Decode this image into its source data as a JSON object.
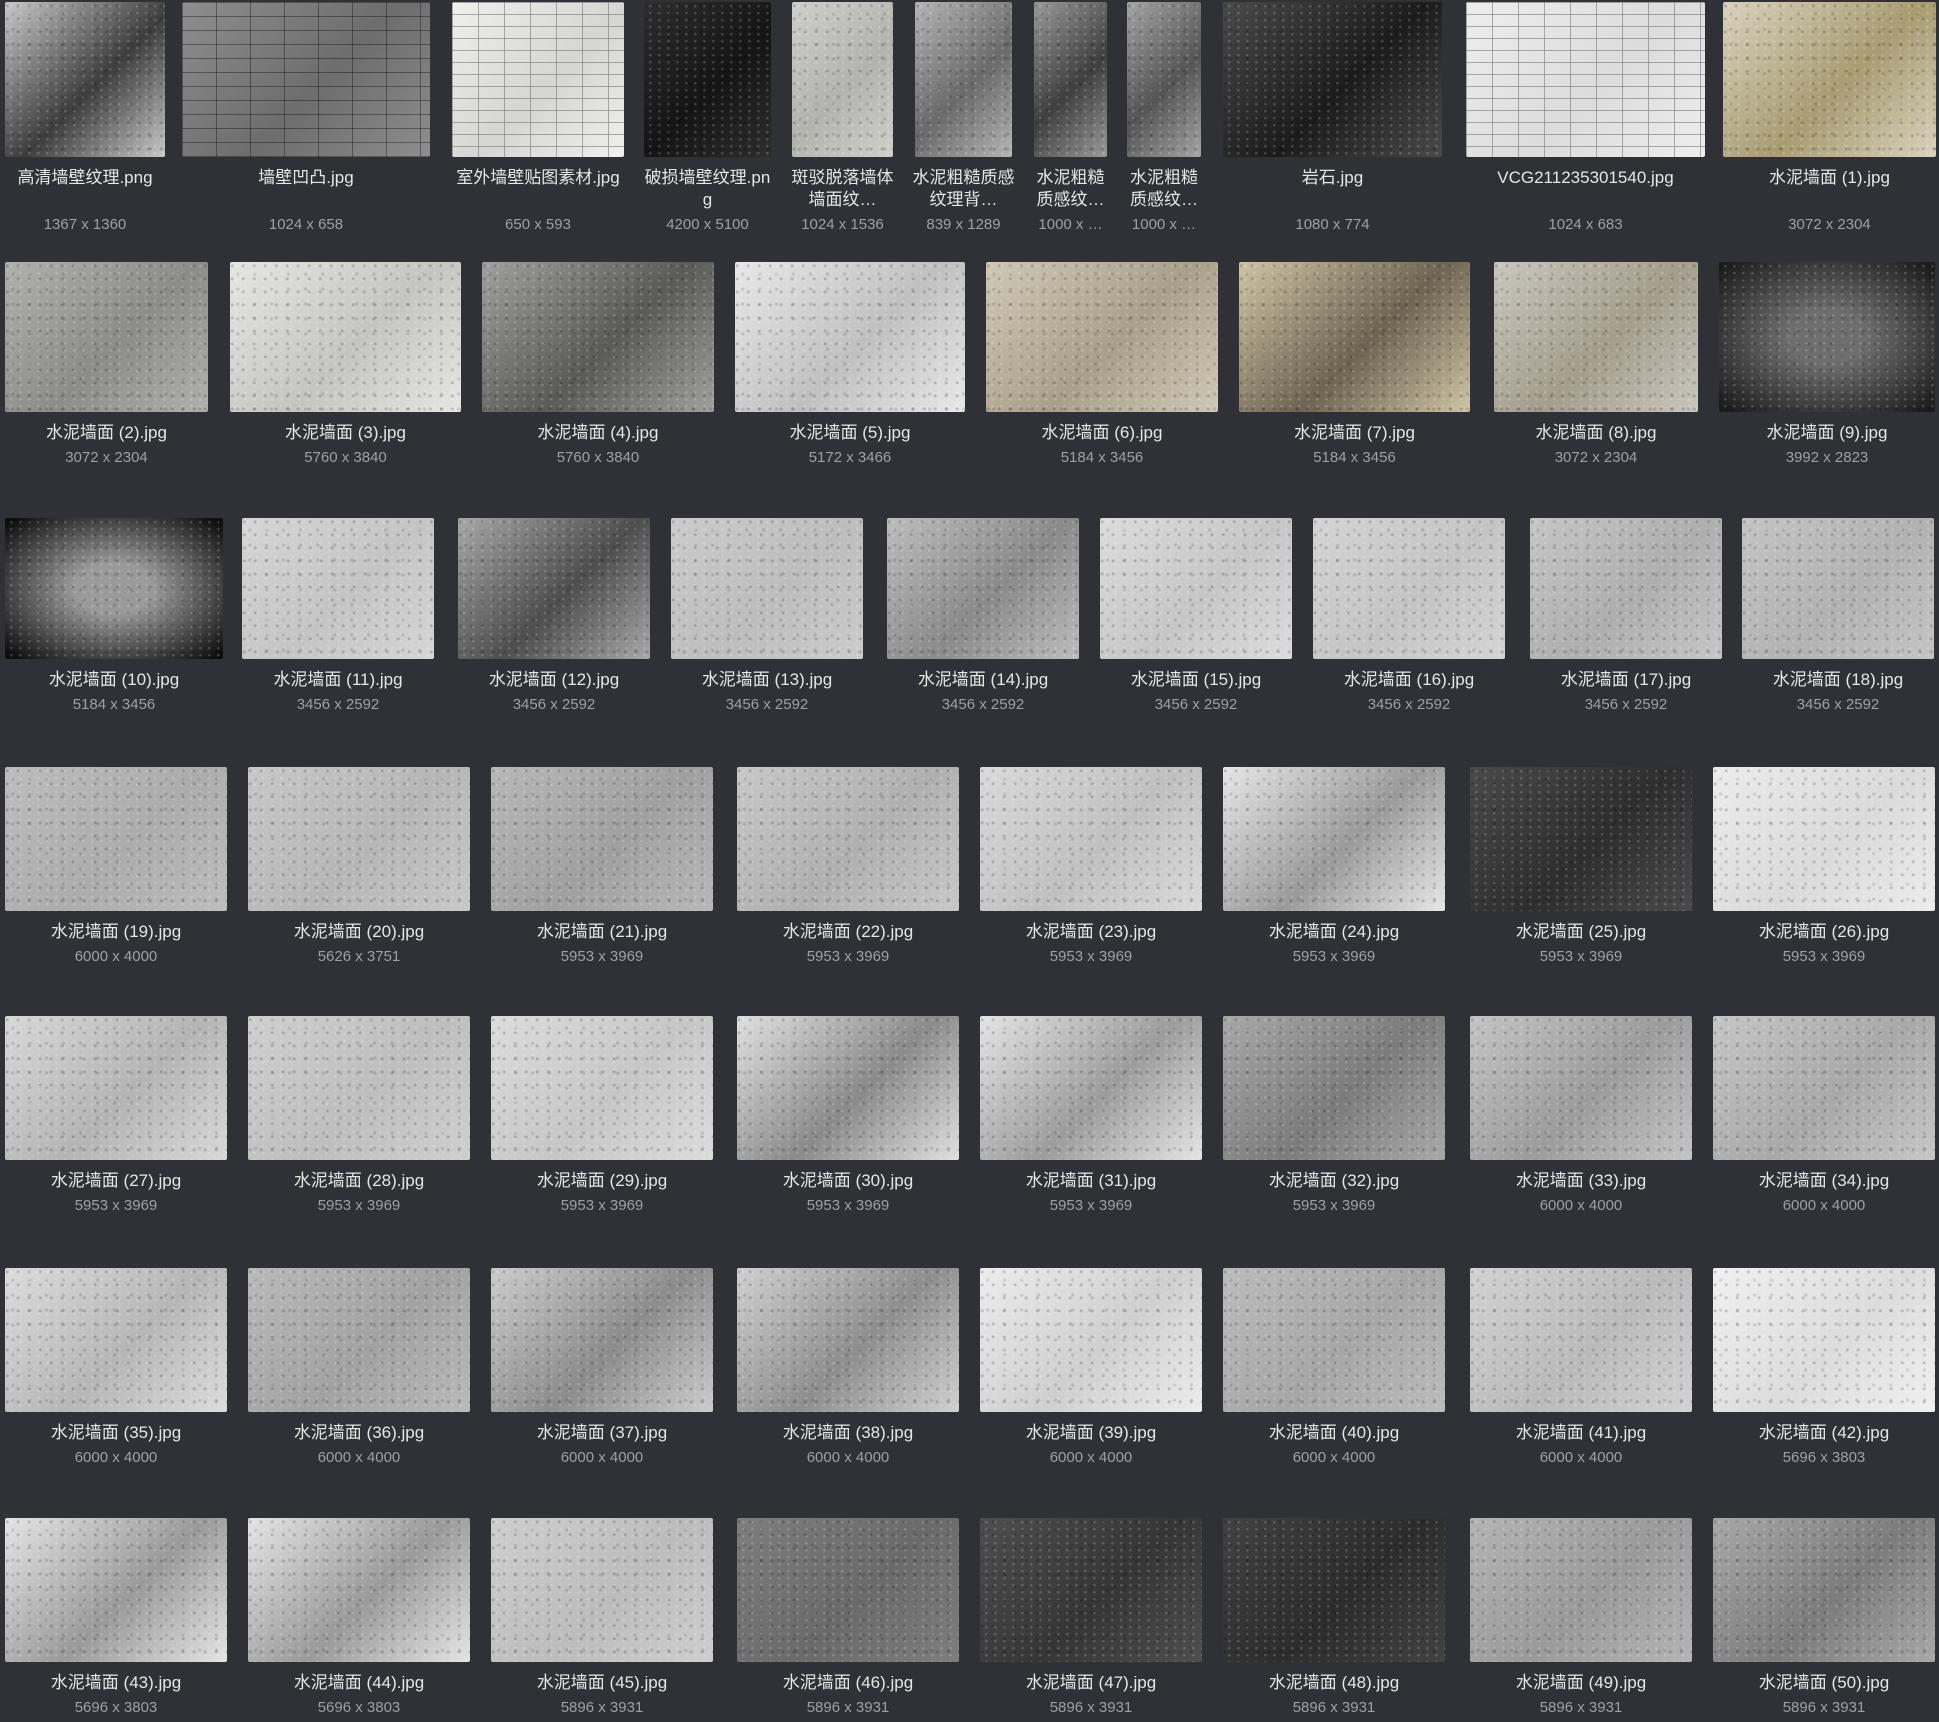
{
  "gallery": {
    "rows": [
      {
        "items": [
          {
            "name": "高清墙壁纹理.png",
            "dims": "1367 x 1360",
            "tone": "#c9c9c9",
            "tone2": "#3d3d3d",
            "pattern": "noise"
          },
          {
            "name": "墙壁凹凸.jpg",
            "dims": "1024 x 658",
            "tone": "#8e8e8e",
            "tone2": "#6d6d6d",
            "pattern": "bricks"
          },
          {
            "name": "室外墙壁贴图素材.jpg",
            "dims": "650 x 593",
            "tone": "#f0f0ee",
            "tone2": "#d5d5d3",
            "pattern": "bricks-light"
          },
          {
            "name": "破损墙壁纹理.png",
            "dims": "4200 x 5100",
            "tone": "#2e2e2e",
            "tone2": "#151515",
            "pattern": "noise"
          },
          {
            "name": "斑驳脱落墙体墙面纹…",
            "dims": "1024 x 1536",
            "tone": "#cfcfcb",
            "tone2": "#b3b3ae",
            "pattern": "noise"
          },
          {
            "name": "水泥粗糙质感纹理背…",
            "dims": "839 x 1289",
            "tone": "#b5b5b5",
            "tone2": "#6a6a6a",
            "pattern": "noise"
          },
          {
            "name": "水泥粗糙质感纹…",
            "dims": "1000 x …",
            "tone": "#9a9a9a",
            "tone2": "#3f3f3f",
            "pattern": "noise"
          },
          {
            "name": "水泥粗糙质感纹…",
            "dims": "1000 x …",
            "tone": "#a4a4a4",
            "tone2": "#555555",
            "pattern": "noise"
          },
          {
            "name": "岩石.jpg",
            "dims": "1080 x 774",
            "tone": "#4a4a4a",
            "tone2": "#1c1c1c",
            "pattern": "noise"
          },
          {
            "name": "VCG211235301540.jpg",
            "dims": "1024 x 683",
            "tone": "#eeeeee",
            "tone2": "#dcdcdc",
            "pattern": "bricks-light"
          },
          {
            "name": "水泥墙面 (1).jpg",
            "dims": "3072 x 2304",
            "tone": "#d8d2bd",
            "tone2": "#a89c72",
            "pattern": "noise"
          }
        ]
      },
      {
        "items": [
          {
            "name": "水泥墙面 (2).jpg",
            "dims": "3072 x 2304",
            "tone": "#b0b0ae",
            "tone2": "#8c8c8a",
            "pattern": "noise"
          },
          {
            "name": "水泥墙面 (3).jpg",
            "dims": "5760 x 3840",
            "tone": "#e6e6e4",
            "tone2": "#c4c4c0",
            "pattern": "noise"
          },
          {
            "name": "水泥墙面 (4).jpg",
            "dims": "5760 x 3840",
            "tone": "#a0a09e",
            "tone2": "#5a5a58",
            "pattern": "noise"
          },
          {
            "name": "水泥墙面 (5).jpg",
            "dims": "5172 x 3466",
            "tone": "#e8e8e8",
            "tone2": "#c0c0c0",
            "pattern": "noise"
          },
          {
            "name": "水泥墙面 (6).jpg",
            "dims": "5184 x 3456",
            "tone": "#cfc8b6",
            "tone2": "#a8a08a",
            "pattern": "noise"
          },
          {
            "name": "水泥墙面 (7).jpg",
            "dims": "5184 x 3456",
            "tone": "#cfc4a4",
            "tone2": "#6e6452",
            "pattern": "noise"
          },
          {
            "name": "水泥墙面 (8).jpg",
            "dims": "3072 x 2304",
            "tone": "#c9c6bd",
            "tone2": "#a39d8c",
            "pattern": "noise"
          },
          {
            "name": "水泥墙面 (9).jpg",
            "dims": "3992 x 2823",
            "tone": "#6e6e6e",
            "tone2": "#1c1c1c",
            "pattern": "vignette"
          }
        ]
      },
      {
        "items": [
          {
            "name": "水泥墙面 (10).jpg",
            "dims": "5184 x 3456",
            "tone": "#9a9a9a",
            "tone2": "#0e0e0e",
            "pattern": "vignette"
          },
          {
            "name": "水泥墙面 (11).jpg",
            "dims": "3456 x 2592",
            "tone": "#d6d6d6",
            "tone2": "#c4c4c4",
            "pattern": "noise"
          },
          {
            "name": "水泥墙面 (12).jpg",
            "dims": "3456 x 2592",
            "tone": "#a8a8a8",
            "tone2": "#4e4e4e",
            "pattern": "noise"
          },
          {
            "name": "水泥墙面 (13).jpg",
            "dims": "3456 x 2592",
            "tone": "#cbcbcb",
            "tone2": "#bdbdbd",
            "pattern": "noise"
          },
          {
            "name": "水泥墙面 (14).jpg",
            "dims": "3456 x 2592",
            "tone": "#bdbdbd",
            "tone2": "#8a8a8a",
            "pattern": "noise"
          },
          {
            "name": "水泥墙面 (15).jpg",
            "dims": "3456 x 2592",
            "tone": "#dcdcdc",
            "tone2": "#c6c6c6",
            "pattern": "noise"
          },
          {
            "name": "水泥墙面 (16).jpg",
            "dims": "3456 x 2592",
            "tone": "#d4d4d4",
            "tone2": "#c4c4c4",
            "pattern": "noise"
          },
          {
            "name": "水泥墙面 (17).jpg",
            "dims": "3456 x 2592",
            "tone": "#c6c6c6",
            "tone2": "#aeaeae",
            "pattern": "noise"
          },
          {
            "name": "水泥墙面 (18).jpg",
            "dims": "3456 x 2592",
            "tone": "#c4c4c4",
            "tone2": "#b2b2b2",
            "pattern": "noise"
          }
        ]
      },
      {
        "items": [
          {
            "name": "水泥墙面 (19).jpg",
            "dims": "6000 x 4000",
            "tone": "#bdbdbd",
            "tone2": "#acacac",
            "pattern": "noise"
          },
          {
            "name": "水泥墙面 (20).jpg",
            "dims": "5626 x 3751",
            "tone": "#c8c8c8",
            "tone2": "#b6b6b6",
            "pattern": "noise"
          },
          {
            "name": "水泥墙面 (21).jpg",
            "dims": "5953 x 3969",
            "tone": "#b8b8b8",
            "tone2": "#a0a0a0",
            "pattern": "noise"
          },
          {
            "name": "水泥墙面 (22).jpg",
            "dims": "5953 x 3969",
            "tone": "#c8c8c8",
            "tone2": "#b0b0b0",
            "pattern": "noise"
          },
          {
            "name": "水泥墙面 (23).jpg",
            "dims": "5953 x 3969",
            "tone": "#dadada",
            "tone2": "#c0c0c0",
            "pattern": "noise"
          },
          {
            "name": "水泥墙面 (24).jpg",
            "dims": "5953 x 3969",
            "tone": "#e6e6e6",
            "tone2": "#9a9a9a",
            "pattern": "noise"
          },
          {
            "name": "水泥墙面 (25).jpg",
            "dims": "5953 x 3969",
            "tone": "#4a4a4a",
            "tone2": "#2e2e2e",
            "pattern": "noise"
          },
          {
            "name": "水泥墙面 (26).jpg",
            "dims": "5953 x 3969",
            "tone": "#ececec",
            "tone2": "#dadada",
            "pattern": "noise"
          }
        ]
      },
      {
        "items": [
          {
            "name": "水泥墙面 (27).jpg",
            "dims": "5953 x 3969",
            "tone": "#d8d8d8",
            "tone2": "#b4b4b4",
            "pattern": "noise"
          },
          {
            "name": "水泥墙面 (28).jpg",
            "dims": "5953 x 3969",
            "tone": "#cfcfcf",
            "tone2": "#bebebe",
            "pattern": "noise"
          },
          {
            "name": "水泥墙面 (29).jpg",
            "dims": "5953 x 3969",
            "tone": "#dcdcdc",
            "tone2": "#c6c6c6",
            "pattern": "noise"
          },
          {
            "name": "水泥墙面 (30).jpg",
            "dims": "5953 x 3969",
            "tone": "#e0e0e0",
            "tone2": "#8a8a8a",
            "pattern": "noise"
          },
          {
            "name": "水泥墙面 (31).jpg",
            "dims": "5953 x 3969",
            "tone": "#e4e4e4",
            "tone2": "#9c9c9c",
            "pattern": "noise"
          },
          {
            "name": "水泥墙面 (32).jpg",
            "dims": "5953 x 3969",
            "tone": "#a8a8a8",
            "tone2": "#7c7c7c",
            "pattern": "noise"
          },
          {
            "name": "水泥墙面 (33).jpg",
            "dims": "6000 x 4000",
            "tone": "#c4c4c4",
            "tone2": "#9c9c9c",
            "pattern": "noise"
          },
          {
            "name": "水泥墙面 (34).jpg",
            "dims": "6000 x 4000",
            "tone": "#c6c6c6",
            "tone2": "#a8a8a8",
            "pattern": "noise"
          }
        ]
      },
      {
        "items": [
          {
            "name": "水泥墙面 (35).jpg",
            "dims": "6000 x 4000",
            "tone": "#dcdcdc",
            "tone2": "#b6b6b6",
            "pattern": "noise"
          },
          {
            "name": "水泥墙面 (36).jpg",
            "dims": "6000 x 4000",
            "tone": "#bababa",
            "tone2": "#a2a2a2",
            "pattern": "noise"
          },
          {
            "name": "水泥墙面 (37).jpg",
            "dims": "6000 x 4000",
            "tone": "#cccccc",
            "tone2": "#8c8c8c",
            "pattern": "noise"
          },
          {
            "name": "水泥墙面 (38).jpg",
            "dims": "6000 x 4000",
            "tone": "#d0d0d0",
            "tone2": "#8e8e8e",
            "pattern": "noise"
          },
          {
            "name": "水泥墙面 (39).jpg",
            "dims": "6000 x 4000",
            "tone": "#ececec",
            "tone2": "#cfcfcf",
            "pattern": "noise"
          },
          {
            "name": "水泥墙面 (40).jpg",
            "dims": "6000 x 4000",
            "tone": "#bcbcbc",
            "tone2": "#a6a6a6",
            "pattern": "noise"
          },
          {
            "name": "水泥墙面 (41).jpg",
            "dims": "6000 x 4000",
            "tone": "#d2d2d2",
            "tone2": "#bababa",
            "pattern": "noise"
          },
          {
            "name": "水泥墙面 (42).jpg",
            "dims": "5696 x 3803",
            "tone": "#f0f0f0",
            "tone2": "#dcdcdc",
            "pattern": "noise"
          }
        ]
      },
      {
        "items": [
          {
            "name": "水泥墙面 (43).jpg",
            "dims": "5696 x 3803",
            "tone": "#e4e4e4",
            "tone2": "#9a9a9a",
            "pattern": "noise"
          },
          {
            "name": "水泥墙面 (44).jpg",
            "dims": "5696 x 3803",
            "tone": "#e4e4e4",
            "tone2": "#9a9a9a",
            "pattern": "noise"
          },
          {
            "name": "水泥墙面 (45).jpg",
            "dims": "5896 x 3931",
            "tone": "#cecece",
            "tone2": "#bcbcbc",
            "pattern": "noise"
          },
          {
            "name": "水泥墙面 (46).jpg",
            "dims": "5896 x 3931",
            "tone": "#7e7e7e",
            "tone2": "#6a6a6a",
            "pattern": "noise"
          },
          {
            "name": "水泥墙面 (47).jpg",
            "dims": "5896 x 3931",
            "tone": "#4e4e4e",
            "tone2": "#363636",
            "pattern": "noise"
          },
          {
            "name": "水泥墙面 (48).jpg",
            "dims": "5896 x 3931",
            "tone": "#424242",
            "tone2": "#2c2c2c",
            "pattern": "noise"
          },
          {
            "name": "水泥墙面 (49).jpg",
            "dims": "5896 x 3931",
            "tone": "#b4b4b4",
            "tone2": "#9a9a9a",
            "pattern": "noise"
          },
          {
            "name": "水泥墙面 (50).jpg",
            "dims": "5896 x 3931",
            "tone": "#a8a8a8",
            "tone2": "#7c7c7c",
            "pattern": "noise"
          }
        ]
      }
    ]
  }
}
